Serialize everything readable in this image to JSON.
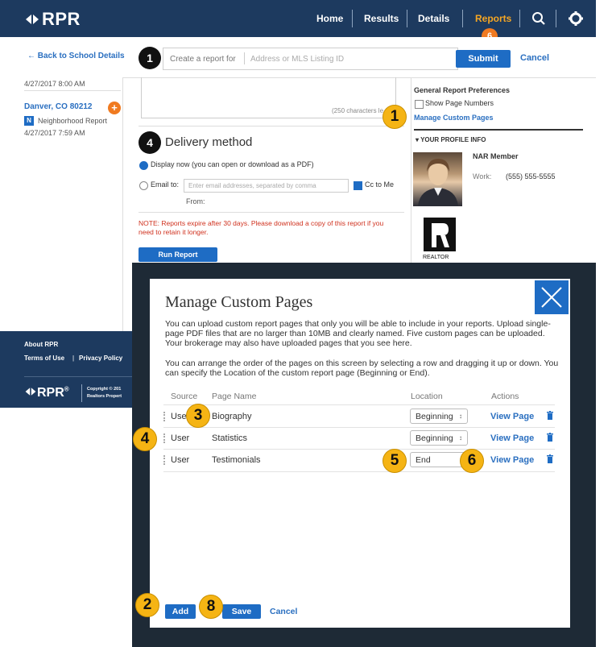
{
  "app": {
    "logo_text": "RPR"
  },
  "nav": {
    "home": "Home",
    "results": "Results",
    "details": "Details",
    "reports": "Reports",
    "reports_badge": "6",
    "search_icon": "search-icon",
    "settings_icon": "gear-icon"
  },
  "report_bar": {
    "back_link": "← Back to School Details",
    "step_number": "1",
    "create_label": "Create a report for",
    "placeholder": "Address or MLS Listing ID",
    "submit": "Submit",
    "cancel": "Cancel"
  },
  "sidebar": {
    "timestamp_top": "4/27/2017 8:00 AM",
    "location": "Danver, CO 80212",
    "report_type_icon": "N",
    "report_type": "Neighborhood Report",
    "timestamp": "4/27/2017 7:59 AM"
  },
  "middle": {
    "char_note": "(250 characters le",
    "step_number": "4",
    "delivery_title": "Delivery method",
    "option_display": "Display now (you can open or download as a PDF)",
    "option_email": "Email to:",
    "email_placeholder": "Enter email addresses, separated by comma",
    "cc_label": "Cc to Me",
    "from_label": "From:",
    "note": "NOTE: Reports expire after 30 days. Please download a copy of this report if you need to retain it longer.",
    "run_button": "Run Report"
  },
  "right_panel": {
    "prefs_title": "General Report Preferences",
    "show_page_numbers": "Show Page Numbers",
    "manage_custom_pages": "Manage Custom Pages",
    "profile_title": "▾ YOUR PROFILE INFO",
    "member_type": "NAR Member",
    "work_label": "Work:",
    "work_phone": "(555) 555-5555",
    "realtor_text": "REALTOR"
  },
  "footer": {
    "about": "About RPR",
    "terms": "Terms of Use",
    "sep": "|",
    "privacy": "Privacy Policy",
    "logo_text": "RPR",
    "reg": "®",
    "copyright_1": "Copyright © 201",
    "copyright_2": "Realtors Propert"
  },
  "modal": {
    "title": "Manage Custom Pages",
    "para1": "You can upload custom report pages that only you will be able to include in your reports. Upload single-page PDF files that are no larger than 10MB and clearly named. Five custom pages can be uploaded. Your brokerage may also have uploaded pages that you see here.",
    "para2": "You can arrange the order of the pages on this screen by selecting a row and dragging it up or down. You can specify the Location of the custom report page (Beginning or End).",
    "columns": {
      "source": "Source",
      "page_name": "Page Name",
      "location": "Location",
      "actions": "Actions"
    },
    "rows": [
      {
        "source": "User",
        "page_name": "Biography",
        "location": "Beginning",
        "action": "View Page"
      },
      {
        "source": "User",
        "page_name": "Statistics",
        "location": "Beginning",
        "action": "View Page"
      },
      {
        "source": "User",
        "page_name": "Testimonials",
        "location": "End",
        "action": "View Page"
      }
    ],
    "select_arrow": "↕",
    "add": "Add",
    "save": "Save",
    "cancel": "Cancel"
  },
  "callouts": {
    "c1": "1",
    "c2": "2",
    "c3": "3",
    "c4": "4",
    "c5": "5",
    "c6": "6",
    "c8": "8"
  },
  "colors": {
    "nav_bg": "#1d3a5f",
    "accent_blue": "#1e6cc4",
    "reports_active": "#f5a623",
    "badge_orange": "#f07a20",
    "callout_yellow": "#f5b414",
    "note_red": "#d0321f"
  }
}
